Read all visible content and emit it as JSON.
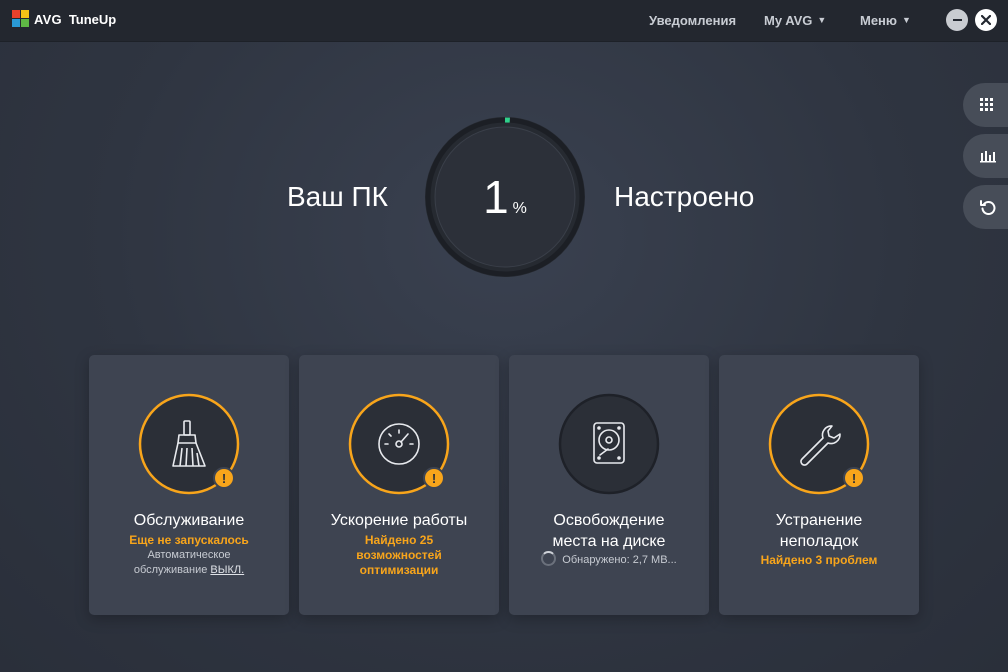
{
  "app": {
    "brand": "AVG",
    "product": "TuneUp"
  },
  "titlebar": {
    "notifications_label": "Уведомления",
    "my_avg_label": "My AVG",
    "menu_label": "Меню"
  },
  "status": {
    "left_text": "Ваш ПК",
    "right_text": "Настроено",
    "percent_value": "1",
    "percent_unit": "%",
    "percent_fraction": 0.01
  },
  "cards": [
    {
      "title": "Обслуживание",
      "status": "Еще не запускалось",
      "detail_1": "Автоматическое",
      "detail_2": "обслуживание",
      "detail_link": "ВЫКЛ.",
      "icon": "broom-icon",
      "alert": "!"
    },
    {
      "title": "Ускорение работы",
      "status_lines": [
        "Найдено 25",
        "возможностей",
        "оптимизации"
      ],
      "icon": "speedometer-icon",
      "alert": "!"
    },
    {
      "title_lines": [
        "Освобождение",
        "места на диске"
      ],
      "progress_text": "Обнаружено: 2,7 МВ...",
      "icon": "hard-drive-icon"
    },
    {
      "title_lines": [
        "Устранение",
        "неполадок"
      ],
      "status": "Найдено 3 проблем",
      "icon": "wrench-icon",
      "alert": "!"
    }
  ],
  "side_panel": {
    "icons": [
      "apps-grid-icon",
      "bar-chart-icon",
      "undo-icon"
    ]
  },
  "colors": {
    "accent_orange": "#f8a51b",
    "gauge_green": "#2fd08b",
    "card_bg": "#3e4451",
    "titlebar_bg": "#23272f"
  }
}
